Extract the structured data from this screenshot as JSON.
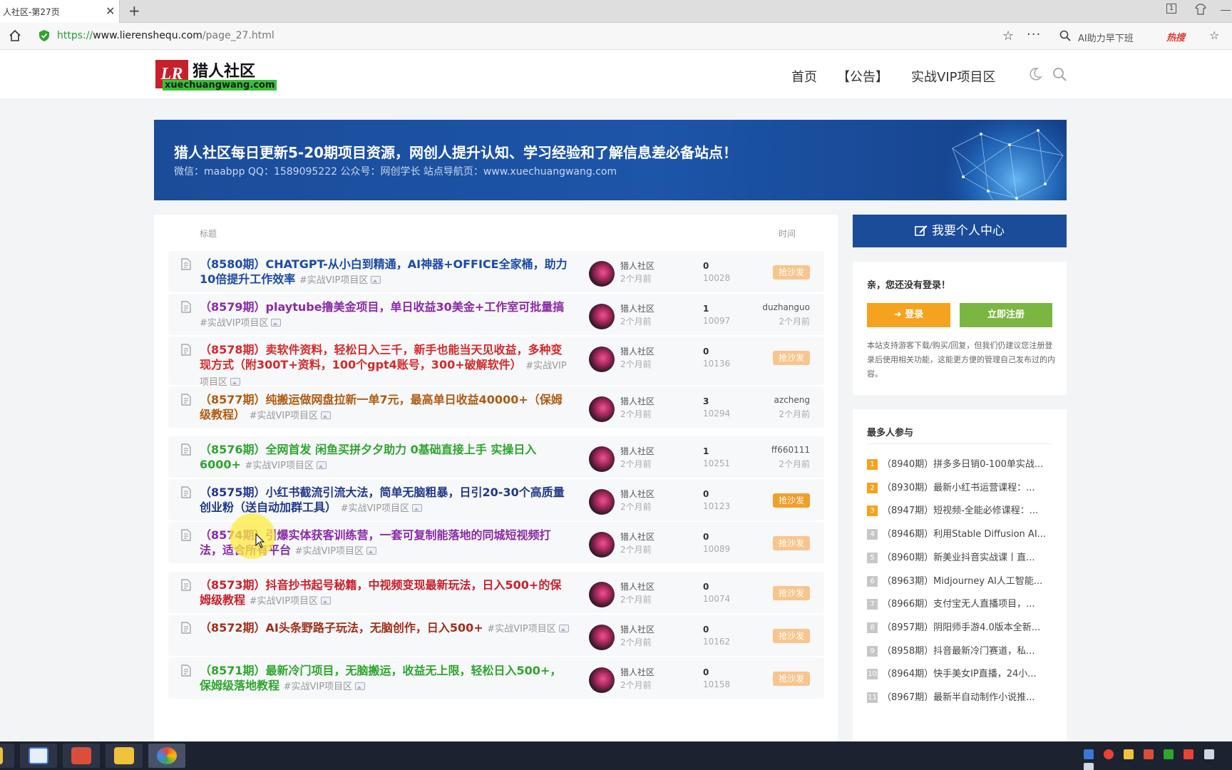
{
  "browser": {
    "tab_title": "人社区-第27页",
    "tab_close": "✕",
    "new_tab": "+",
    "url_scheme": "https://",
    "url_host": "www.lierenshequ.com",
    "url_path": "/page_27.html",
    "search_placeholder": "AI助力早下班",
    "hot_label": "热搜",
    "win_badge": "1"
  },
  "site": {
    "logo_badge": "LR",
    "logo_name": "猎人社区",
    "logo_domain": "xuechuangwang.com",
    "nav": [
      "首页",
      "【公告】",
      "实战VIP项目区"
    ]
  },
  "banner": {
    "title": "猎人社区每日更新5-20期项目资源，网创人提升认知、学习经验和了解信息差必备站点！",
    "subtitle": "微信：maabpp QQ：1589095222 公众号：网创学长 站点导航页：www.xuechuangwang.com"
  },
  "list": {
    "header_title": "标题",
    "header_time": "时间",
    "rows": [
      {
        "title": "（8580期）CHATGPT-从小白到精通，AI神器+OFFICE全家桶，助力10倍提升工作效率",
        "tag": "#实战VIP项目区",
        "color": "#1b4aa3",
        "author": "猎人社区",
        "posted": "2个月前",
        "replies": "0",
        "views": "10028",
        "sofa": "抢沙发",
        "sofa_strong": false,
        "last_user": "",
        "last_time": ""
      },
      {
        "title": "（8579期）playtube撸美金项目，单日收益30美金+工作室可批量搞",
        "tag": "#实战VIP项目区",
        "color": "#8a2aa8",
        "author": "猎人社区",
        "posted": "2个月前",
        "replies": "1",
        "views": "10097",
        "sofa": "",
        "sofa_strong": false,
        "last_user": "duzhanguo",
        "last_time": "2个月前"
      },
      {
        "title": "（8578期）卖软件资料，轻松日入三千，新手也能当天见收益，多种变现方式（附300T+资料，100个gpt4账号，300+破解软件）",
        "tag": "#实战VIP项目区",
        "color": "#d42a2a",
        "author": "猎人社区",
        "posted": "2个月前",
        "replies": "0",
        "views": "10136",
        "sofa": "抢沙发",
        "sofa_strong": false,
        "last_user": "",
        "last_time": ""
      },
      {
        "title": "（8577期）纯搬运做网盘拉新一单7元，最高单日收益40000+（保姆级教程）",
        "tag": "#实战VIP项目区",
        "color": "#b05a10",
        "author": "猎人社区",
        "posted": "2个月前",
        "replies": "3",
        "views": "10294",
        "sofa": "",
        "sofa_strong": false,
        "last_user": "azcheng",
        "last_time": "2个月前"
      },
      {
        "title": "（8576期）全网首发 闲鱼买拼夕夕助力 0基础直接上手 实操日入6000+",
        "tag": "#实战VIP项目区",
        "color": "#2ea52e",
        "author": "猎人社区",
        "posted": "2个月前",
        "replies": "1",
        "views": "10251",
        "sofa": "",
        "sofa_strong": false,
        "last_user": "ff660111",
        "last_time": "2个月前"
      },
      {
        "title": "（8575期）小红书截流引流大法，简单无脑粗暴，日引20-30个高质量创业粉（送自动加群工具）",
        "tag": "#实战VIP项目区",
        "color": "#203a8a",
        "author": "猎人社区",
        "posted": "2个月前",
        "replies": "0",
        "views": "10123",
        "sofa": "抢沙发",
        "sofa_strong": true,
        "last_user": "",
        "last_time": ""
      },
      {
        "title": "（8574期）引爆实体获客训练营，一套可复制能落地的同城短视频打法，适合所有平台",
        "tag": "#实战VIP项目区",
        "color": "#8a2aa8",
        "author": "猎人社区",
        "posted": "2个月前",
        "replies": "0",
        "views": "10089",
        "sofa": "抢沙发",
        "sofa_strong": false,
        "last_user": "",
        "last_time": ""
      },
      {
        "title": "（8573期）抖音抄书起号秘籍，中视频变现最新玩法，日入500+的保姆级教程",
        "tag": "#实战VIP项目区",
        "color": "#c8202a",
        "author": "猎人社区",
        "posted": "2个月前",
        "replies": "0",
        "views": "10074",
        "sofa": "抢沙发",
        "sofa_strong": false,
        "last_user": "",
        "last_time": ""
      },
      {
        "title": "（8572期）AI头条野路子玩法，无脑创作，日入500+",
        "tag": "#实战VIP项目区",
        "color": "#a0301a",
        "author": "猎人社区",
        "posted": "2个月前",
        "replies": "0",
        "views": "10162",
        "sofa": "抢沙发",
        "sofa_strong": false,
        "last_user": "",
        "last_time": ""
      },
      {
        "title": "（8571期）最新冷门项目，无脑搬运，收益无上限，轻松日入500+，保姆级落地教程",
        "tag": "#实战VIP项目区",
        "color": "#2ea52e",
        "author": "猎人社区",
        "posted": "2个月前",
        "replies": "0",
        "views": "10158",
        "sofa": "抢沙发",
        "sofa_strong": false,
        "last_user": "",
        "last_time": ""
      }
    ]
  },
  "sidebar": {
    "profile_button": "我要个人中心",
    "greeting": "亲，您还没有登录！",
    "login_button": "登录",
    "register_button": "立即注册",
    "note": "本站支持游客下载/购买/回复，但我们仍建议您注册登录后使用相关功能，这能更方便的管理自己发布过的内容。",
    "hot_title": "最多人参与",
    "hot_items": [
      {
        "rank": "1",
        "text": "（8940期）拼多多日销0-100单实战..."
      },
      {
        "rank": "2",
        "text": "（8930期）最新小红书运营课程：..."
      },
      {
        "rank": "3",
        "text": "（8947期）短视频-全能必修课程：..."
      },
      {
        "rank": "4",
        "text": "（8946期）利用Stable Diffusion AI..."
      },
      {
        "rank": "5",
        "text": "（8960期）新美业抖音实战课丨直..."
      },
      {
        "rank": "6",
        "text": "（8963期）Midjourney AI人工智能..."
      },
      {
        "rank": "7",
        "text": "（8966期）支付宝无人直播项目，..."
      },
      {
        "rank": "8",
        "text": "（8957期）阴阳师手游4.0版本全新..."
      },
      {
        "rank": "9",
        "text": "（8958期）抖音最新冷门赛道，私..."
      },
      {
        "rank": "10",
        "text": "（8964期）快手美女IP直播，24小..."
      },
      {
        "rank": "11",
        "text": "（8967期）最新半自动制作小说推..."
      }
    ]
  },
  "colors": {
    "brand_blue": "#1b4c9a",
    "login_orange": "#f5a21f",
    "register_green": "#7cb642"
  }
}
